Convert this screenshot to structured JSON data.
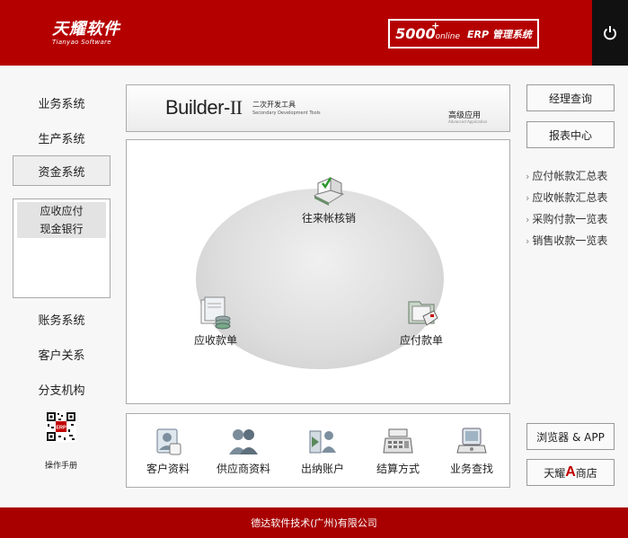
{
  "header": {
    "logo_name": "天耀软件",
    "logo_sub": "Tianyao Software",
    "product_num": "5000",
    "product_plus": "+",
    "product_online": "online",
    "product_erp": "ERP 管理系统",
    "power_icon": "power-icon"
  },
  "sidebar": {
    "items": [
      {
        "label": "业务系统"
      },
      {
        "label": "生产系统"
      },
      {
        "label": "资金系统"
      },
      {
        "label": "账务系统"
      },
      {
        "label": "客户关系"
      },
      {
        "label": "分支机构"
      }
    ],
    "sub_items": [
      {
        "label": "应收应付"
      },
      {
        "label": "现金银行"
      }
    ],
    "qr_label": "操作手册",
    "qr_badge": "ERP"
  },
  "banner": {
    "name": "Builder-",
    "roman": "II",
    "cn": "二次开发工具",
    "en": "Secondary Development Tools",
    "adv": "高级应用",
    "adv_en": "Advanced Application"
  },
  "workspace": {
    "nodes": [
      {
        "label": "往来帐核销",
        "icon": "reconcile-icon"
      },
      {
        "label": "应收款单",
        "icon": "receivable-icon"
      },
      {
        "label": "应付款单",
        "icon": "payable-icon"
      }
    ]
  },
  "tools": [
    {
      "label": "客户资料",
      "icon": "customer-icon"
    },
    {
      "label": "供应商资料",
      "icon": "supplier-icon"
    },
    {
      "label": "出纳账户",
      "icon": "cashier-icon"
    },
    {
      "label": "结算方式",
      "icon": "cash-register-icon"
    },
    {
      "label": "业务查找",
      "icon": "search-terminal-icon"
    }
  ],
  "right": {
    "manager_query": "经理查询",
    "report_center": "报表中心",
    "links": [
      {
        "label": "应付帐款汇总表"
      },
      {
        "label": "应收帐款汇总表"
      },
      {
        "label": "采购付款一览表"
      },
      {
        "label": "销售收款一览表"
      }
    ],
    "link_arrow": "›",
    "browser_app": "浏览器 & APP",
    "shop_pre": "天耀",
    "shop_a": "A",
    "shop_post": "商店"
  },
  "footer": {
    "company": "德达软件技术(广州)有限公司"
  },
  "colors": {
    "brand_red": "#b50000",
    "footer_red": "#a80000"
  }
}
